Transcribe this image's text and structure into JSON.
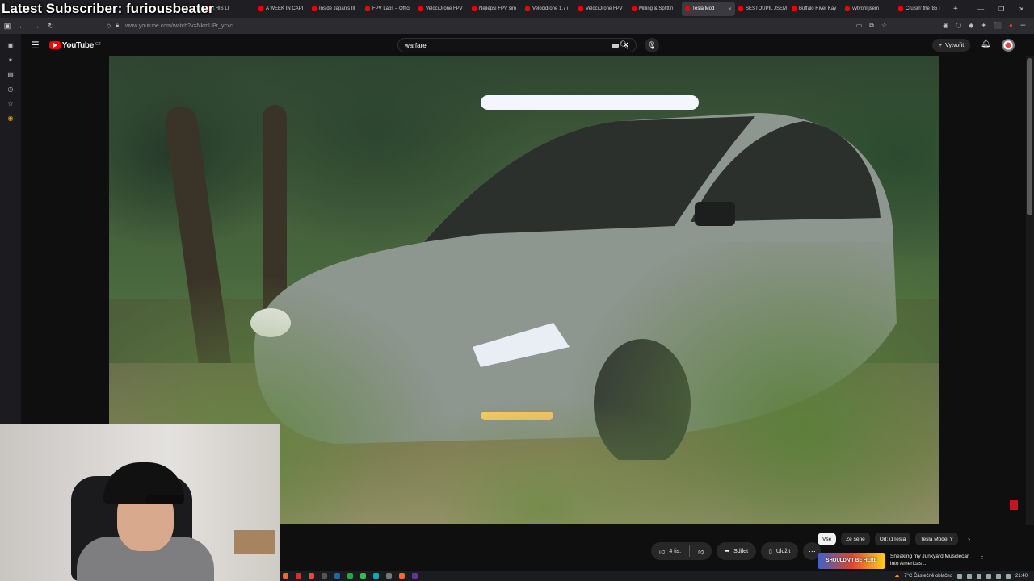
{
  "overlay": {
    "subscriber_text": "Latest Subscriber: furiousbeater"
  },
  "browser": {
    "tabs": [
      {
        "label": "THIS LI"
      },
      {
        "label": "A WEEK IN CAPI"
      },
      {
        "label": "Inside Japan's Ill"
      },
      {
        "label": "FPV Labs – Offici"
      },
      {
        "label": "VelociDrone FPV"
      },
      {
        "label": "Nejlepší FPV sim"
      },
      {
        "label": "Velocidrone 1.7 i"
      },
      {
        "label": "VelociDrone FPV"
      },
      {
        "label": "Milling & Splittin"
      },
      {
        "label": "Tesla Mod"
      },
      {
        "label": "SESTOUPIL JSEM"
      },
      {
        "label": "Buffalo River Kay"
      },
      {
        "label": "vytvořil jsem"
      },
      {
        "label": "Cruisin' the '85 I"
      }
    ],
    "active_tab_index": 9,
    "new_tab": "+",
    "url": "www.youtube.com/watch?v=NkmUPr_ycxc"
  },
  "youtube": {
    "logo_text": "YouTube",
    "logo_region": "CZ",
    "search_value": "warfare",
    "create_label": "Vytvořit"
  },
  "actions": {
    "like_count": "4 tis.",
    "share_label": "Sdílet",
    "save_label": "Uložit"
  },
  "chips": [
    {
      "label": "Vše",
      "active": true
    },
    {
      "label": "Ze série",
      "active": false
    },
    {
      "label": "Od: i1Tesla",
      "active": false
    },
    {
      "label": "Tesla Model Y",
      "active": false
    }
  ],
  "recommended": {
    "thumbnail_text": "SHOULDN'T BE HERE",
    "title": "Sneaking my Junkyard Musclecar into Americas ..."
  },
  "taskbar": {
    "weather": "7°C  Částečně oblačno",
    "time": "21:40"
  },
  "colors": {
    "accent": "#ff0000",
    "chip_bg": "#272727",
    "page_bg": "#0f0f0f"
  }
}
